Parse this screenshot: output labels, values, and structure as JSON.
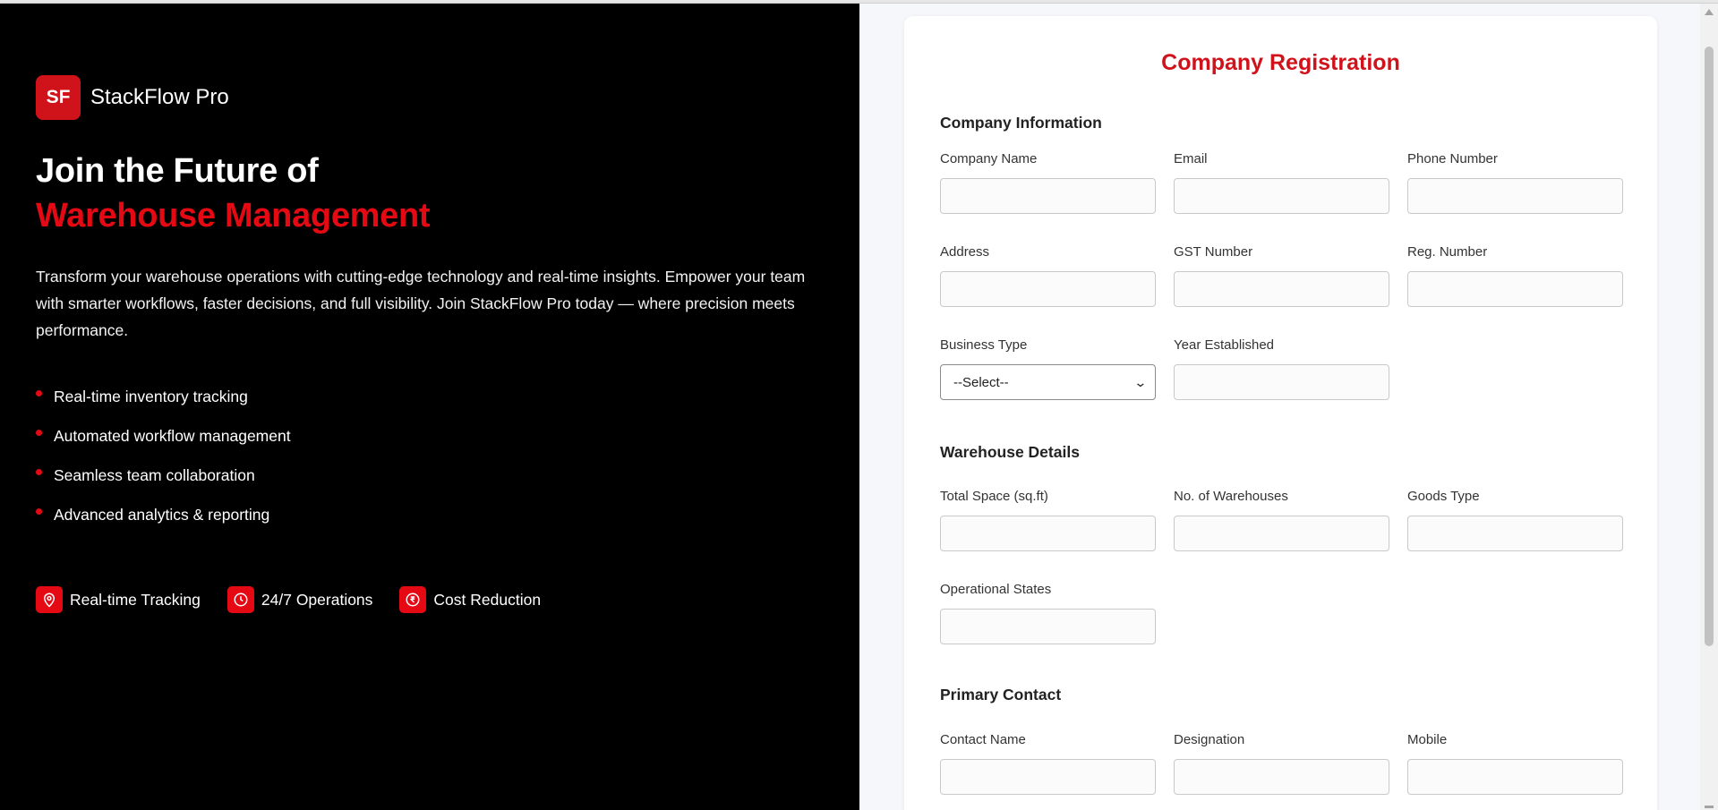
{
  "brand": {
    "badge": "SF",
    "name": "StackFlow Pro"
  },
  "hero": {
    "line1": "Join the Future of",
    "line2": "Warehouse Management"
  },
  "description": "Transform your warehouse operations with cutting-edge technology and real-time insights. Empower your team with smarter workflows, faster decisions, and full visibility. Join StackFlow Pro today — where precision meets performance.",
  "features": [
    "Real-time inventory tracking",
    "Automated workflow management",
    "Seamless team collaboration",
    "Advanced analytics & reporting"
  ],
  "badges": [
    {
      "icon": "location-pin-icon",
      "label": "Real-time Tracking"
    },
    {
      "icon": "clock-icon",
      "label": "24/7 Operations"
    },
    {
      "icon": "rupee-icon",
      "label": "Cost Reduction"
    }
  ],
  "form": {
    "title": "Company Registration",
    "sections": {
      "company": "Company Information",
      "warehouse": "Warehouse Details",
      "contact": "Primary Contact"
    },
    "fields": {
      "company_name": "Company Name",
      "email": "Email",
      "phone": "Phone Number",
      "address": "Address",
      "gst": "GST Number",
      "reg": "Reg. Number",
      "business_type": "Business Type",
      "business_type_value": "--Select--",
      "year": "Year Established",
      "total_space": "Total Space (sq.ft)",
      "num_warehouses": "No. of Warehouses",
      "goods_type": "Goods Type",
      "states": "Operational States",
      "contact_name": "Contact Name",
      "designation": "Designation",
      "mobile": "Mobile"
    }
  },
  "colors": {
    "accent": "#e50914",
    "left_bg": "#000000",
    "right_bg": "#f5f7fb"
  }
}
